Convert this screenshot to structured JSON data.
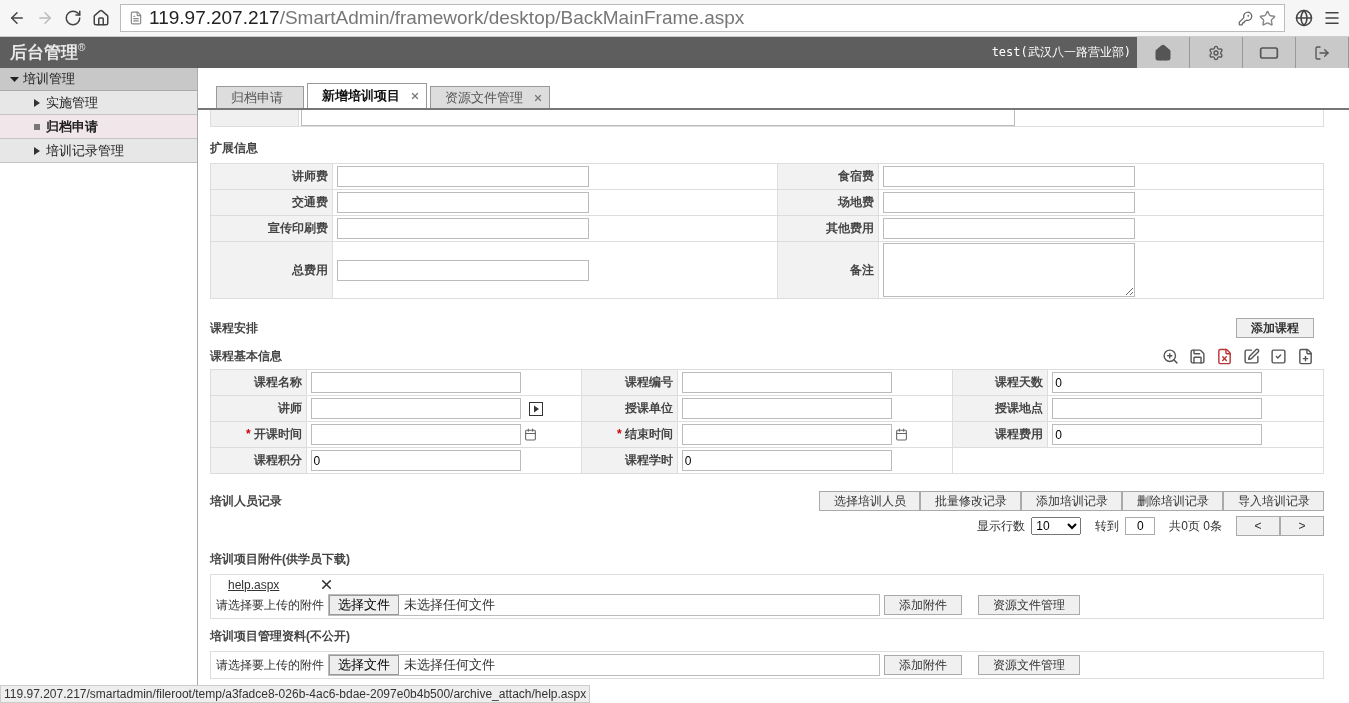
{
  "browser": {
    "url_host": "119.97.207.217",
    "url_path": "/SmartAdmin/framework/desktop/BackMainFrame.aspx"
  },
  "header": {
    "title": "后台管理",
    "mark": "®",
    "user": "test(武汉八一路营业部)"
  },
  "sidebar": {
    "items": [
      {
        "label": "培训管理",
        "expanded": true,
        "children": [
          {
            "label": "实施管理",
            "selected": false
          },
          {
            "label": "归档申请",
            "selected": true
          },
          {
            "label": "培训记录管理",
            "selected": false
          }
        ]
      }
    ]
  },
  "tabs": [
    {
      "label": "归档申请",
      "selected": false,
      "closable": false
    },
    {
      "label": "新增培训项目",
      "selected": true,
      "closable": true
    },
    {
      "label": "资源文件管理",
      "selected": false,
      "closable": true
    }
  ],
  "extension": {
    "title": "扩展信息",
    "rows": [
      [
        {
          "label": "讲师费",
          "kind": "text"
        },
        {
          "label": "食宿费",
          "kind": "text"
        }
      ],
      [
        {
          "label": "交通费",
          "kind": "text"
        },
        {
          "label": "场地费",
          "kind": "text"
        }
      ],
      [
        {
          "label": "宣传印刷费",
          "kind": "text"
        },
        {
          "label": "其他费用",
          "kind": "text"
        }
      ],
      [
        {
          "label": "总费用",
          "kind": "text"
        },
        {
          "label": "备注",
          "kind": "textarea"
        }
      ]
    ]
  },
  "course": {
    "required_mark": "*",
    "title": "课程安排",
    "add_button": "添加课程",
    "basic_title": "课程基本信息",
    "rows": [
      [
        {
          "label": "课程名称",
          "required": false,
          "kind": "text"
        },
        {
          "label": "课程编号",
          "required": false,
          "kind": "text"
        },
        {
          "label": "课程天数",
          "value": "0",
          "required": false,
          "kind": "text"
        }
      ],
      [
        {
          "label": "讲师",
          "required": false,
          "kind": "picker"
        },
        {
          "label": "授课单位",
          "required": false,
          "kind": "text"
        },
        {
          "label": "授课地点",
          "required": false,
          "kind": "text"
        }
      ],
      [
        {
          "label": "开课时间",
          "required": true,
          "kind": "date"
        },
        {
          "label": "结束时间",
          "required": true,
          "kind": "date"
        },
        {
          "label": "课程费用",
          "value": "0",
          "required": false,
          "kind": "text"
        }
      ],
      [
        {
          "label": "课程积分",
          "value": "0",
          "required": false,
          "kind": "text"
        },
        {
          "label": "课程学时",
          "value": "0",
          "required": false,
          "kind": "text"
        }
      ]
    ]
  },
  "trainees": {
    "title": "培训人员记录",
    "buttons": [
      "选择培训人员",
      "批量修改记录",
      "添加培训记录",
      "删除培训记录",
      "导入培训记录"
    ],
    "pager": {
      "rows_label": "显示行数",
      "rows_value": "10",
      "goto_label": "转到",
      "goto_value": "0",
      "total": "共0页 0条",
      "prev": "<",
      "next": ">"
    }
  },
  "attachments": [
    {
      "title": "培训项目附件(供学员下载)",
      "files": [
        "help.aspx"
      ],
      "prompt": "请选择要上传的附件",
      "choose": "选择文件",
      "no_file": "未选择任何文件",
      "buttons": [
        "添加附件",
        "资源文件管理"
      ]
    },
    {
      "title": "培训项目管理资料(不公开)",
      "prompt": "请选择要上传的附件",
      "choose": "选择文件",
      "no_file": "未选择任何文件",
      "buttons": [
        "添加附件",
        "资源文件管理"
      ]
    }
  ],
  "status_url": "119.97.207.217/smartadmin/fileroot/temp/a3fadce8-026b-4ac6-bdae-2097e0b4b500/archive_attach/help.aspx"
}
